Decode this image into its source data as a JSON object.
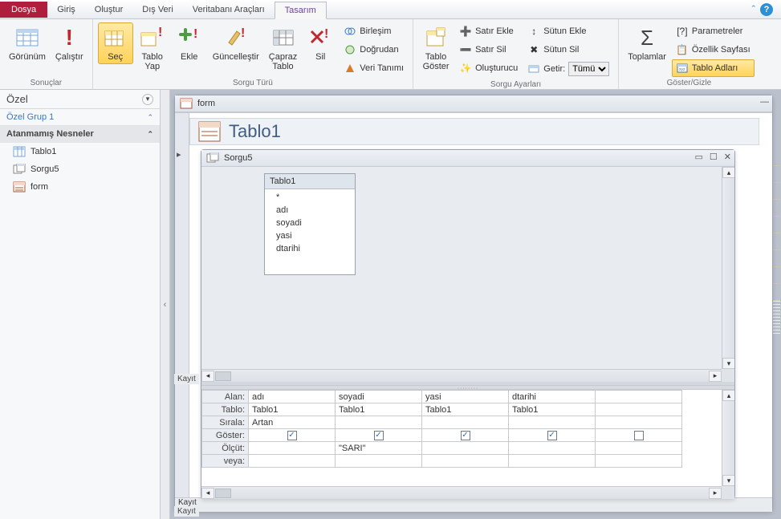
{
  "tabs": {
    "file": "Dosya",
    "home": "Giriş",
    "create": "Oluştur",
    "external": "Dış Veri",
    "dbtools": "Veritabanı Araçları",
    "design": "Tasarım"
  },
  "ribbon": {
    "results": {
      "label": "Sonuçlar",
      "view": "Görünüm",
      "run": "Çalıştır"
    },
    "query_type": {
      "label": "Sorgu Türü",
      "select": "Seç",
      "make_table": "Tablo\nYap",
      "append": "Ekle",
      "update": "Güncelleştir",
      "crosstab": "Çapraz\nTablo",
      "delete": "Sil",
      "union": "Birleşim",
      "passthrough": "Doğrudan",
      "data_def": "Veri Tanımı"
    },
    "setup": {
      "label": "Sorgu Ayarları",
      "show_table": "Tablo\nGöster",
      "insert_row": "Satır Ekle",
      "delete_row": "Satır Sil",
      "builder": "Oluşturucu",
      "insert_col": "Sütun Ekle",
      "delete_col": "Sütun Sil",
      "return_label": "Getir:",
      "return_value": "Tümü"
    },
    "showhide": {
      "label": "Göster/Gizle",
      "totals": "Toplamlar",
      "parameters": "Parametreler",
      "property": "Özellik Sayfası",
      "table_names": "Tablo Adları"
    }
  },
  "nav": {
    "title": "Özel",
    "group1": "Özel Grup 1",
    "group2": "Atanmamış Nesneler",
    "items": {
      "table1": "Tablo1",
      "query5": "Sorgu5",
      "form": "form"
    }
  },
  "windows": {
    "form_title": "form",
    "form_heading": "Tablo1",
    "sorgu_title": "Sorgu5",
    "record_label": "Kayıt"
  },
  "table_box": {
    "title": "Tablo1",
    "star": "*",
    "fields": [
      "adı",
      "soyadi",
      "yasi",
      "dtarihi"
    ]
  },
  "qbe": {
    "row_field": "Alan:",
    "row_table": "Tablo:",
    "row_sort": "Sırala:",
    "row_show": "Göster:",
    "row_criteria": "Ölçüt:",
    "row_or": "veya:",
    "cols": [
      {
        "field": "adı",
        "table": "Tablo1",
        "sort": "Artan",
        "show": true,
        "criteria": ""
      },
      {
        "field": "soyadi",
        "table": "Tablo1",
        "sort": "",
        "show": true,
        "criteria": "\"SARI\""
      },
      {
        "field": "yasi",
        "table": "Tablo1",
        "sort": "",
        "show": true,
        "criteria": ""
      },
      {
        "field": "dtarihi",
        "table": "Tablo1",
        "sort": "",
        "show": true,
        "criteria": ""
      },
      {
        "field": "",
        "table": "",
        "sort": "",
        "show": false,
        "criteria": ""
      }
    ]
  }
}
